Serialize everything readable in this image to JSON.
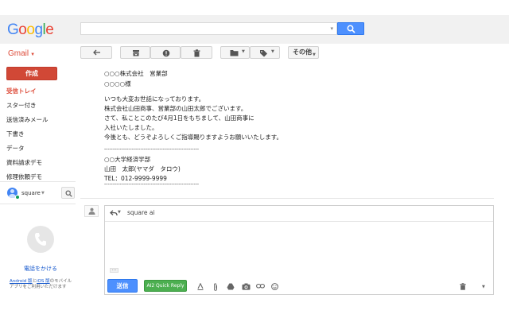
{
  "header": {
    "logo": [
      "G",
      "o",
      "o",
      "g",
      "l",
      "e"
    ],
    "search_value": ""
  },
  "toolbar": {
    "app_label": "Gmail",
    "more_label": "その他"
  },
  "sidebar": {
    "compose": "作成",
    "items": [
      {
        "label": "受信トレイ"
      },
      {
        "label": "スター付き"
      },
      {
        "label": "送信済みメール"
      },
      {
        "label": "下書き"
      },
      {
        "label": "データ"
      },
      {
        "label": "資料請求デモ"
      },
      {
        "label": "修理依頼デモ"
      }
    ],
    "hangouts_user": "square",
    "call_link": "電話をかける",
    "apps_link_android": "Android 版",
    "apps_mid": "と",
    "apps_link_ios": "iOS 版",
    "apps_tail": "のモバイルアプリをご利用いただけます"
  },
  "message": {
    "lines": [
      "○○○株式会社　営業部",
      "○○○○様",
      "いつも大変お世話になっております。",
      "株式会社山田商事、営業部の山田太郎でございます。",
      "さて、私ことこのたび4月1日をもちまして、山田商事に",
      "入社いたしました。",
      "今後とも、どうぞよろしくご指導賜りますようお願いいたします。",
      "-------------------------------------------------------",
      "○○大学経済学部",
      "山田　太郎(ヤマダ　タロウ)",
      "TEL：012-9999-9999",
      "-------------------------------------------------------"
    ]
  },
  "reply": {
    "to": "square ai",
    "send_label": "送信",
    "quick_reply_label": "AI2 Quick Reply",
    "trim_label": "..."
  },
  "colors": {
    "accent_red": "#d14836",
    "accent_blue": "#4d90fe",
    "quick_reply_green": "#4caf50"
  }
}
